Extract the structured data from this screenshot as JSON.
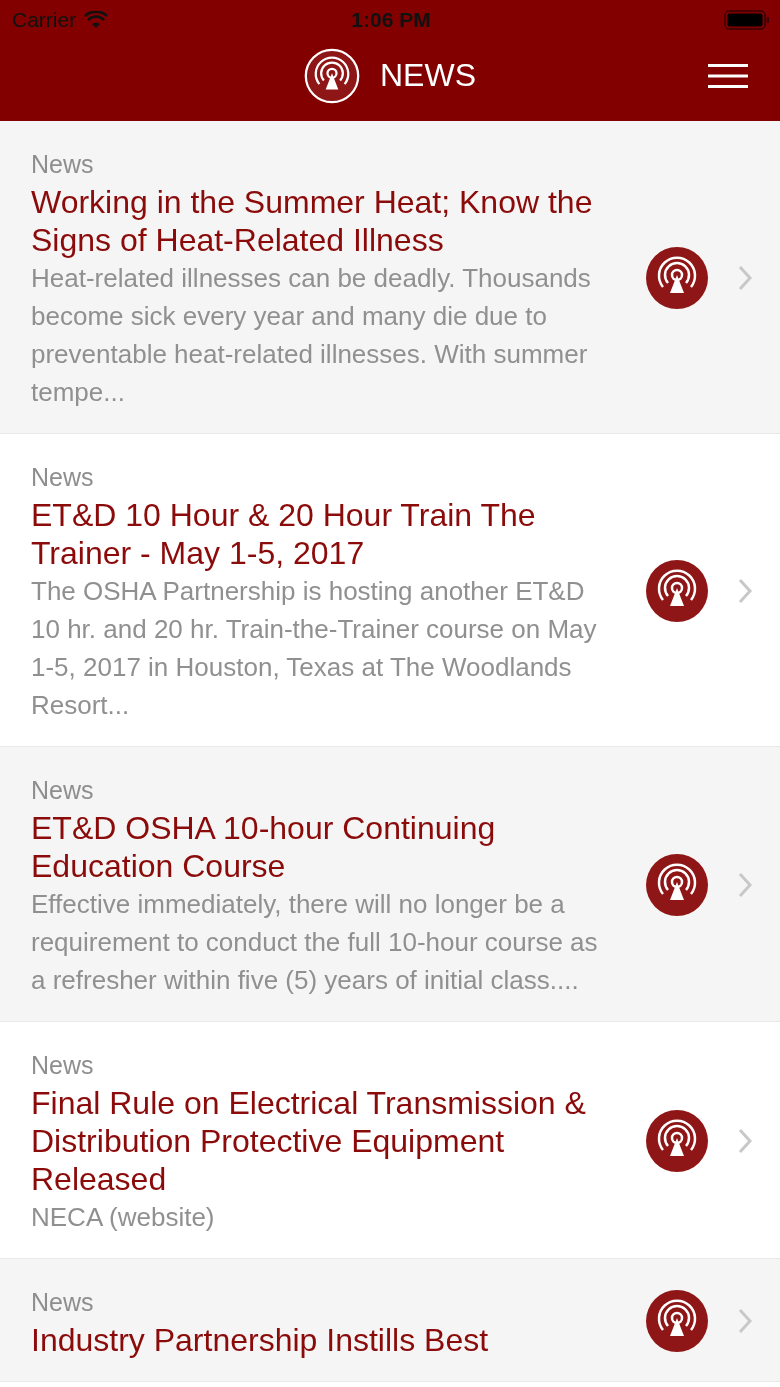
{
  "status_bar": {
    "carrier": "Carrier",
    "time": "1:06 PM"
  },
  "header": {
    "title": "NEWS"
  },
  "items": [
    {
      "category": "News",
      "title": "Working in the Summer Heat; Know the Signs of Heat-Related Illness",
      "summary": "Heat-related illnesses can be deadly. Thousands become sick every year and many die due to preventable heat-related illnesses. With summer tempe..."
    },
    {
      "category": "News",
      "title": "ET&D 10 Hour & 20 Hour Train The Trainer - May 1-5, 2017",
      "summary": "The OSHA Partnership is hosting another ET&D 10 hr. and 20 hr. Train-the-Trainer course on May 1-5, 2017 in Houston, Texas at The Woodlands Resort..."
    },
    {
      "category": "News",
      "title": "ET&D OSHA 10-hour Continuing Education Course",
      "summary": "Effective immediately, there will no longer be a requirement to conduct the full 10-hour course as a refresher within five (5) years of initial class...."
    },
    {
      "category": "News",
      "title": "Final Rule on Electrical Transmission & Distribution Protective Equipment Released",
      "summary": "NECA (website)"
    },
    {
      "category": "News",
      "title": "Industry Partnership Instills Best"
    }
  ]
}
